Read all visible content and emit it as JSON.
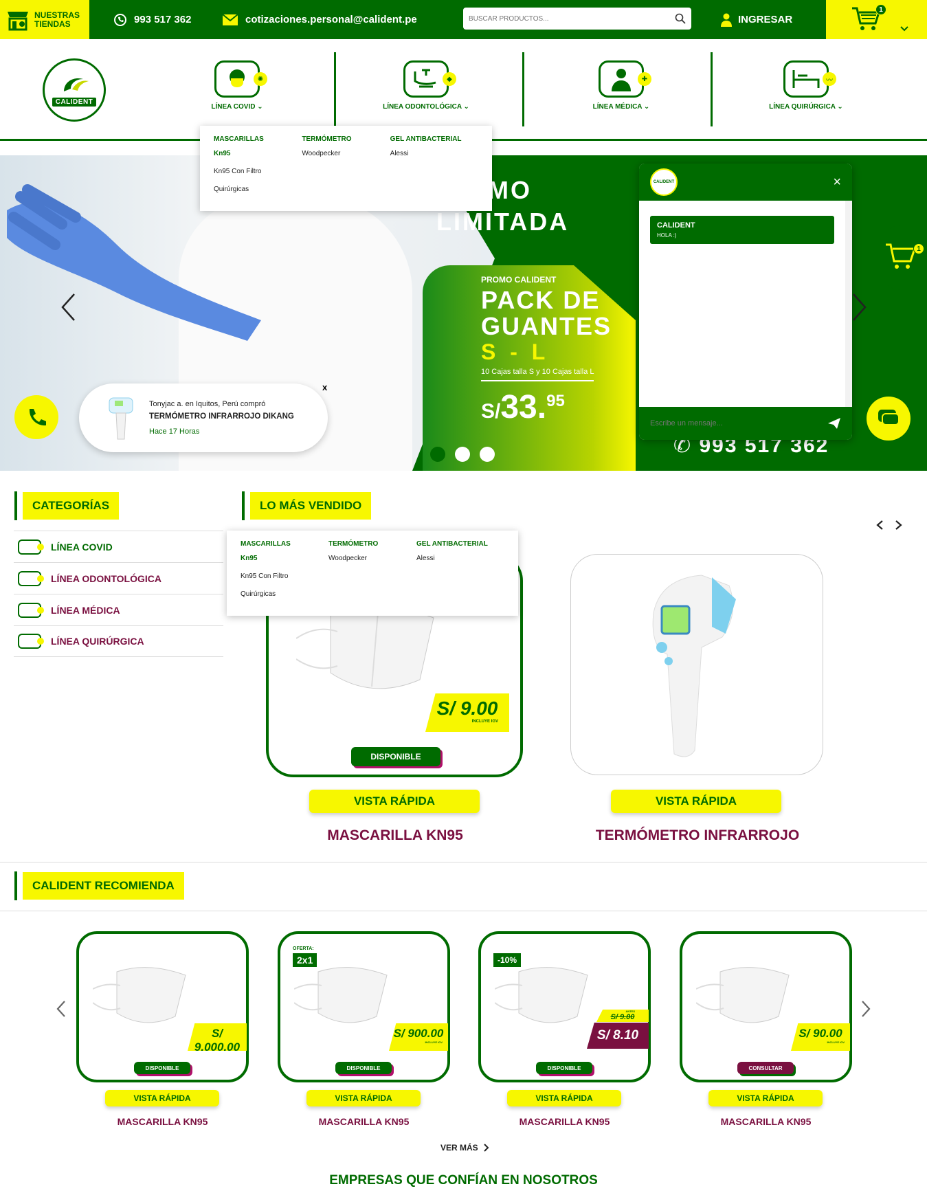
{
  "topbar": {
    "stores_label": "NUESTRAS TIENDAS",
    "phone": "993 517 362",
    "email": "cotizaciones.personal@calident.pe",
    "search_placeholder": "BUSCAR PRODUCTOS...",
    "login_label": "INGRESAR",
    "cart_count": "1"
  },
  "brand": {
    "logo_text": "CALIDENT",
    "colors": {
      "green": "#006b00",
      "yellow": "#f7f700",
      "maroon": "#7a1040"
    }
  },
  "nav": {
    "items": [
      {
        "label": "LÍNEA COVID",
        "icon": "mask-person-icon"
      },
      {
        "label": "LÍNEA ODONTOLÓGICA",
        "icon": "dental-chair-icon"
      },
      {
        "label": "LÍNEA MÉDICA",
        "icon": "doctor-icon"
      },
      {
        "label": "LÍNEA QUIRÚRGICA",
        "icon": "surgical-bed-icon"
      }
    ]
  },
  "dropdown": {
    "columns": [
      {
        "heading": "MASCARILLAS",
        "items": [
          "Kn95",
          "Kn95 Con Filtro",
          "Quirúrgicas"
        ]
      },
      {
        "heading": "TERMÓMETRO",
        "items": [
          "Woodpecker"
        ]
      },
      {
        "heading": "GEL ANTIBACTERIAL",
        "items": [
          "Alessi"
        ]
      }
    ]
  },
  "hero": {
    "promo_line1": "OMO",
    "promo_line2": "LIMITADA",
    "small": "PROMO CALIDENT",
    "big1": "PACK DE",
    "big2": "GUANTES",
    "sizes": "S - L",
    "note": "10 Cajas talla S y 10 Cajas talla L",
    "currency": "S/",
    "price_int": "33.",
    "price_dec": "95",
    "phone": "993 517 362",
    "slides_total": 3,
    "slide_active": 1
  },
  "notification": {
    "line1": "Tonyjac a. en Iquitos, Perú compró",
    "line2": "TERMÓMETRO INFRARROJO DIKANG",
    "line3": "Hace 17 Horas",
    "close": "x"
  },
  "chat": {
    "close": "×",
    "sender": "CALIDENT",
    "message": "HOLA :)",
    "input_placeholder": "Escribe un mensaje..."
  },
  "categories": {
    "heading": "CATEGORÍAS",
    "items": [
      "LÍNEA COVID",
      "LÍNEA ODONTOLÓGICA",
      "LÍNEA MÉDICA",
      "LÍNEA QUIRÚRGICA"
    ]
  },
  "bestsellers": {
    "heading": "LO MÁS VENDIDO",
    "products": [
      {
        "title": "MASCARILLA KN95",
        "price": "S/ 9.00",
        "tax": "INCLUYE IGV",
        "status": "DISPONIBLE",
        "quick": "VISTA RÁPIDA"
      },
      {
        "title": "TERMÓMETRO INFRARROJO",
        "quick": "VISTA RÁPIDA"
      }
    ]
  },
  "recommend": {
    "heading": "CALIDENT RECOMIENDA",
    "products": [
      {
        "title": "MASCARILLA KN95",
        "price": "S/ 9.000.00",
        "tax": "INCLUYE IGV",
        "status": "DISPONIBLE",
        "quick": "VISTA RÁPIDA"
      },
      {
        "title": "MASCARILLA KN95",
        "price": "S/ 900.00",
        "tax": "INCLUYE IGV",
        "status": "DISPONIBLE",
        "quick": "VISTA RÁPIDA",
        "offer_label": "OFERTA:",
        "offer": "2x1"
      },
      {
        "title": "MASCARILLA KN95",
        "price": "S/ 8.10",
        "old_price": "S/ 9.00",
        "old_label": "ANTES",
        "status": "DISPONIBLE",
        "quick": "VISTA RÁPIDA",
        "discount": "-10%"
      },
      {
        "title": "MASCARILLA KN95",
        "price": "S/ 90.00",
        "tax": "INCLUYE IGV",
        "status": "CONSULTAR",
        "quick": "VISTA RÁPIDA"
      }
    ],
    "more": "VER MÁS"
  },
  "trust_heading": "EMPRESAS QUE CONFÍAN EN NOSOTROS"
}
